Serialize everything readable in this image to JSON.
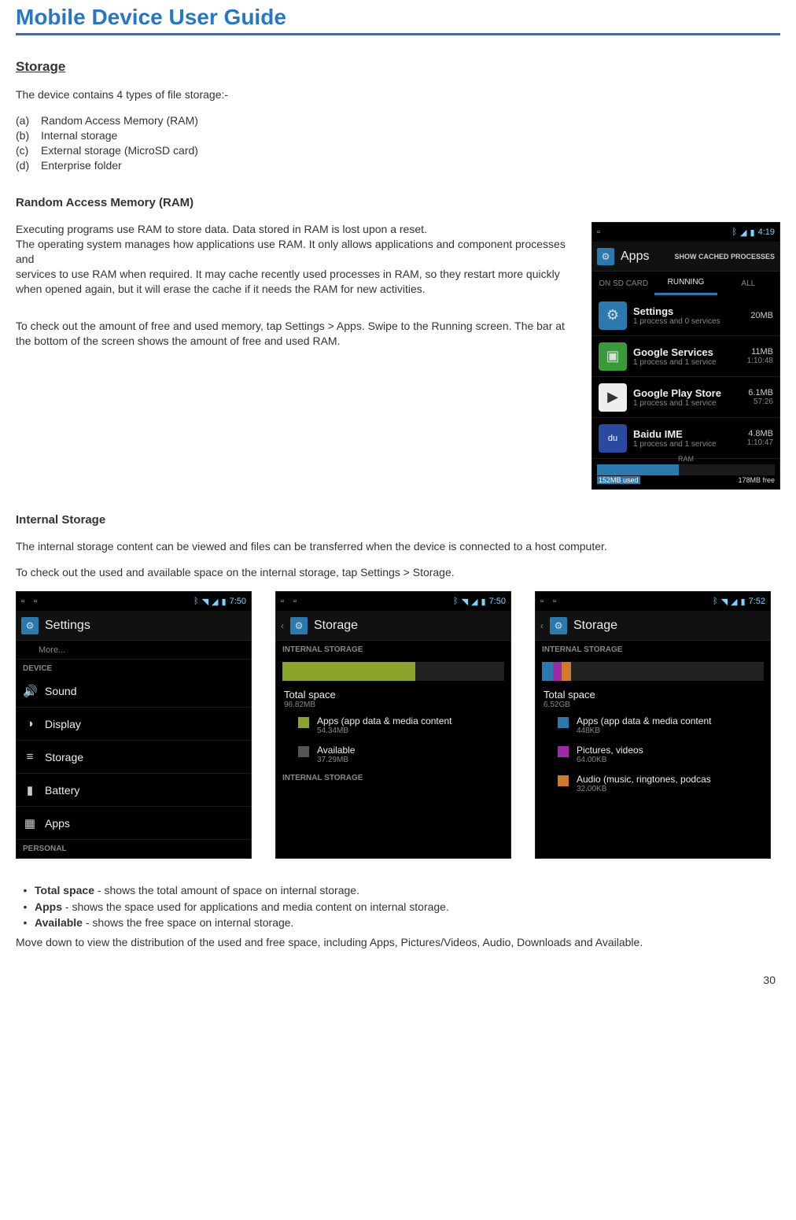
{
  "header": {
    "title": "Mobile Device User Guide"
  },
  "page_number": "30",
  "storage_section": {
    "heading": "Storage",
    "intro": "The device contains 4 types of file storage:-",
    "items": [
      {
        "mk": "(a)",
        "txt": "Random Access Memory (RAM)"
      },
      {
        "mk": "(b)",
        "txt": "Internal storage"
      },
      {
        "mk": "(c)",
        "txt": "External storage (MicroSD card)"
      },
      {
        "mk": "(d)",
        "txt": "Enterprise folder"
      }
    ]
  },
  "ram_section": {
    "heading": "Random Access Memory (RAM)",
    "p1": "Executing programs use RAM to store data. Data stored in RAM is lost upon a reset.",
    "p2a": "The operating system manages how applications use RAM. It only allows applications and component processes and",
    "p2b": "services to use RAM when required. It may cache recently used processes in RAM, so they restart more quickly when opened again, but it will erase the cache if it needs the RAM for new activities.",
    "p3": "To check out the amount of free and used memory, tap Settings > Apps. Swipe to the Running screen. The bar at the bottom of the screen shows the amount of free and used RAM."
  },
  "internal_section": {
    "heading": "Internal Storage",
    "p1": "The internal storage content can be viewed and files can be transferred when the device is connected to a host computer.",
    "p2": "To check out the used and available space on the internal storage, tap Settings > Storage."
  },
  "bullets": {
    "b1": {
      "label": "Total space",
      "txt": " - shows the total amount of space on internal storage."
    },
    "b2": {
      "label": "Apps",
      "txt": " - shows the space used for applications and media content on internal storage."
    },
    "b3": {
      "label": "Available",
      "txt": " - shows the free space on internal storage."
    },
    "tail": "Move down to view the distribution of the used and free space, including Apps, Pictures/Videos, Audio, Downloads and Available."
  },
  "bullet_mark": "•",
  "shot_apps": {
    "time": "4:19",
    "title": "Apps",
    "action": "SHOW CACHED PROCESSES",
    "tabs": {
      "t1": "ON SD CARD",
      "t2": "RUNNING",
      "t3": "ALL"
    },
    "rows": [
      {
        "name": "Settings",
        "sub": "1 process and 0 services",
        "size": "20MB",
        "time": "",
        "color": "#2a7ab0",
        "glyph": "⚙"
      },
      {
        "name": "Google Services",
        "sub": "1 process and 1 service",
        "size": "11MB",
        "time": "1:10:48",
        "color": "#3a9a3a",
        "glyph": "▣"
      },
      {
        "name": "Google Play Store",
        "sub": "1 process and 1 service",
        "size": "6.1MB",
        "time": "57:26",
        "color": "#eee",
        "glyph": "▶"
      },
      {
        "name": "Baidu IME",
        "sub": "1 process and 1 service",
        "size": "4.8MB",
        "time": "1:10:47",
        "color": "#2a4aa0",
        "glyph": "du"
      }
    ],
    "ram": {
      "label": "RAM",
      "used": "152MB used",
      "free": "178MB free"
    }
  },
  "shot_settings": {
    "time": "7:50",
    "title": "Settings",
    "more": "More...",
    "cat": "DEVICE",
    "rows": [
      {
        "icon": "🔊",
        "lbl": "Sound"
      },
      {
        "icon": "◑",
        "lbl": "Display"
      },
      {
        "icon": "≡",
        "lbl": "Storage"
      },
      {
        "icon": "▮",
        "lbl": "Battery"
      },
      {
        "icon": "▦",
        "lbl": "Apps"
      }
    ],
    "cat2": "PERSONAL"
  },
  "shot_storage1": {
    "time": "7:50",
    "title": "Storage",
    "cat": "INTERNAL STORAGE",
    "total_lbl": "Total space",
    "total_val": "96.82MB",
    "items": [
      {
        "color": "#8aa52a",
        "name": "Apps (app data & media content",
        "val": "54.34MB"
      },
      {
        "color": "#555",
        "name": "Available",
        "val": "37.29MB"
      }
    ],
    "cat2": "INTERNAL STORAGE"
  },
  "shot_storage2": {
    "time": "7:52",
    "title": "Storage",
    "cat": "INTERNAL STORAGE",
    "total_lbl": "Total space",
    "total_val": "6.52GB",
    "items": [
      {
        "color": "#2a7ab0",
        "name": "Apps (app data & media content",
        "val": "448KB"
      },
      {
        "color": "#a02aa5",
        "name": "Pictures, videos",
        "val": "64.00KB"
      },
      {
        "color": "#d07a2a",
        "name": "Audio (music, ringtones, podcas",
        "val": "32.00KB"
      }
    ]
  }
}
